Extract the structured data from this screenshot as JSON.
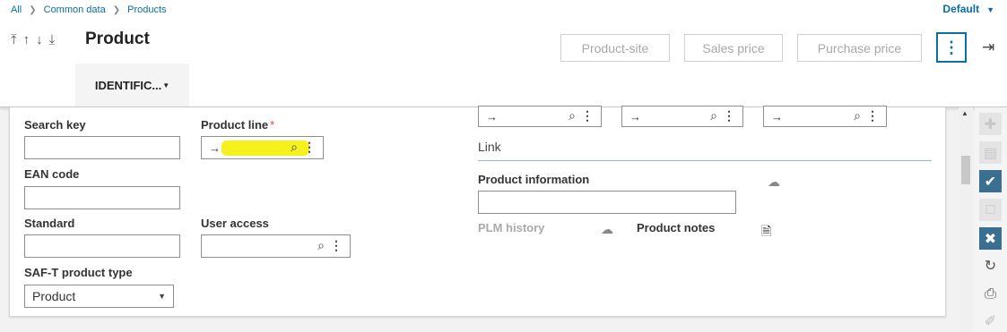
{
  "breadcrumb": {
    "all": "All",
    "common": "Common data",
    "products": "Products"
  },
  "header": {
    "default_label": "Default",
    "title": "Product",
    "product_site": "Product-site",
    "sales_price": "Sales price",
    "purchase_price": "Purchase price",
    "tab": "IDENTIFIC..."
  },
  "form": {
    "search_key": {
      "label": "Search key",
      "value": ""
    },
    "ean_code": {
      "label": "EAN code",
      "value": ""
    },
    "standard": {
      "label": "Standard",
      "value": ""
    },
    "saft_type": {
      "label": "SAF-T product type",
      "value": "Product"
    },
    "product_line": {
      "label": "Product line",
      "required": "*",
      "value": ""
    },
    "user_access": {
      "label": "User access",
      "value": ""
    },
    "link_section": "Link",
    "product_information": {
      "label": "Product information",
      "value": ""
    },
    "plm_history": "PLM history",
    "product_notes": "Product notes"
  },
  "icons": {
    "arrow": "→",
    "search": "🔍",
    "kebab": "⋮"
  },
  "colors": {
    "accent": "#0a6ea3",
    "highlight": "#f4f11d",
    "required": "#e8452c",
    "active_action": "#3b6f91"
  }
}
